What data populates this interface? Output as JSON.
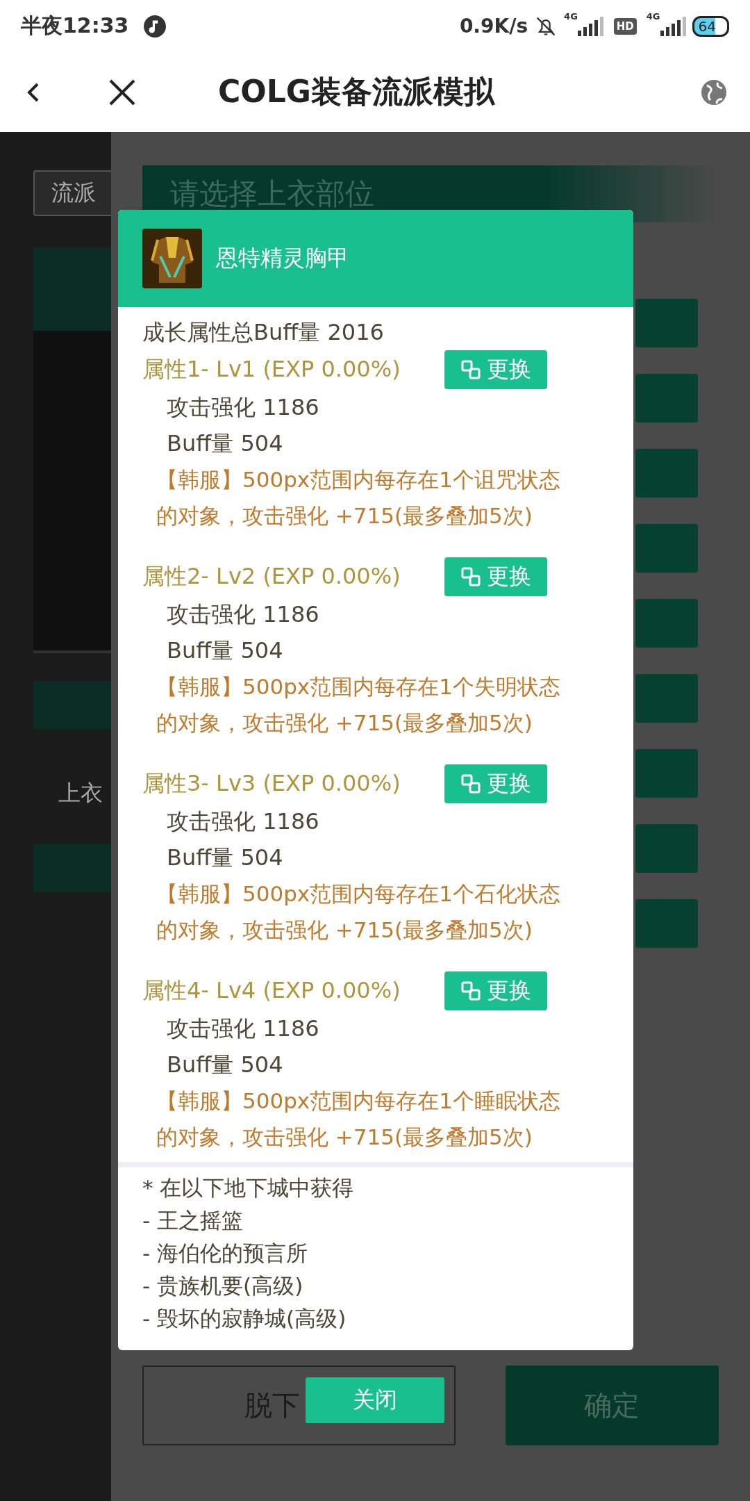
{
  "status_bar": {
    "time": "半夜12:33",
    "network_speed": "0.9K/s",
    "signals": [
      {
        "label": "4G"
      },
      {
        "label": "4G"
      }
    ],
    "hd_badge": "HD",
    "battery": "64"
  },
  "header": {
    "title": "COLG装备流派模拟"
  },
  "background": {
    "scheme_select": "流派",
    "section_title": "请选择上衣部位",
    "slot_label": "上衣",
    "buttons": [
      {
        "label": "脱下",
        "kind": "outline"
      },
      {
        "label": "确定",
        "kind": "filled"
      }
    ]
  },
  "dialog": {
    "item_name": "恩特精灵胸甲",
    "growth_total": "成长属性总Buff量 2016",
    "attributes": [
      {
        "title": "属性1- Lv1 (EXP 0.00%)",
        "change_button": "更换",
        "stats": [
          "攻击强化 1186",
          "Buff量 504"
        ],
        "effect": "【韩服】500px范围内每存在1个诅咒状态的对象，攻击强化 +715(最多叠加5次)"
      },
      {
        "title": "属性2- Lv2 (EXP 0.00%)",
        "change_button": "更换",
        "stats": [
          "攻击强化 1186",
          "Buff量 504"
        ],
        "effect": "【韩服】500px范围内每存在1个失明状态的对象，攻击强化 +715(最多叠加5次)"
      },
      {
        "title": "属性3- Lv3 (EXP 0.00%)",
        "change_button": "更换",
        "stats": [
          "攻击强化 1186",
          "Buff量 504"
        ],
        "effect": "【韩服】500px范围内每存在1个石化状态的对象，攻击强化 +715(最多叠加5次)"
      },
      {
        "title": "属性4- Lv4 (EXP 0.00%)",
        "change_button": "更换",
        "stats": [
          "攻击强化 1186",
          "Buff量 504"
        ],
        "effect": "【韩服】500px范围内每存在1个睡眠状态的对象，攻击强化 +715(最多叠加5次)"
      }
    ],
    "source_heading": "* 在以下地下城中获得",
    "sources": [
      "- 王之摇篮",
      "- 海伯伦的预言所",
      "- 贵族机要(高级)",
      "- 毁坏的寂静城(高级)"
    ],
    "close_button": "关闭"
  }
}
